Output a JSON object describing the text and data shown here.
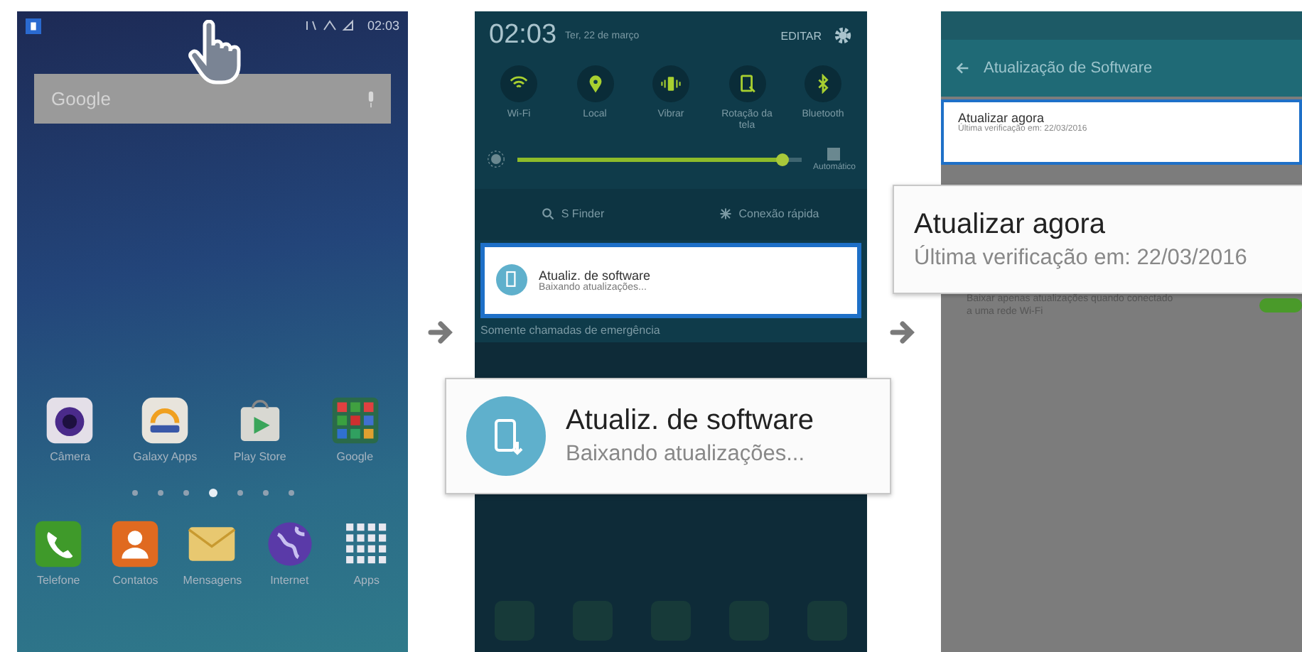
{
  "home_screen": {
    "status_bar": {
      "time": "02:03"
    },
    "search_bar": {
      "placeholder": "Google"
    },
    "apps": [
      {
        "label": "Câmera",
        "kind": "camera"
      },
      {
        "label": "Galaxy Apps",
        "kind": "store"
      },
      {
        "label": "Play Store",
        "kind": "bag"
      },
      {
        "label": "Google",
        "kind": "folder"
      }
    ],
    "page_dots": [
      {
        "selected": false
      },
      {
        "selected": false
      },
      {
        "selected": false
      },
      {
        "selected": true
      },
      {
        "selected": false
      },
      {
        "selected": false
      },
      {
        "selected": false
      }
    ],
    "dock": [
      {
        "label": "Telefone",
        "kind": "phone"
      },
      {
        "label": "Contatos",
        "kind": "person"
      },
      {
        "label": "Mensagens",
        "kind": "envelope"
      },
      {
        "label": "Internet",
        "kind": "globe"
      },
      {
        "label": "Apps",
        "kind": "grid"
      }
    ]
  },
  "notification_panel": {
    "time": "02:03",
    "date": "Ter, 22 de março",
    "edit_button": "EDITAR",
    "quick_toggles": [
      {
        "label": "Wi-Fi",
        "kind": "wifi",
        "on": true
      },
      {
        "label": "Local",
        "kind": "location",
        "on": true
      },
      {
        "label": "Vibrar",
        "kind": "vibrate",
        "on": true
      },
      {
        "label": "Rotação da tela",
        "kind": "rotation",
        "on": true
      },
      {
        "label": "Bluetooth",
        "kind": "bluetooth",
        "on": true
      }
    ],
    "brightness": {
      "level": 0.93,
      "label": "Automático"
    },
    "s_finder": "S Finder",
    "quick_connect": "Conexão rápida",
    "notification": {
      "title": "Atualiz. de software",
      "subtitle": "Baixando atualizações..."
    },
    "emergency_text": "Somente chamadas de emergência"
  },
  "notification_callout": {
    "title": "Atualiz. de software",
    "subtitle": "Baixando atualizações..."
  },
  "update_screen": {
    "title": "Atualização de Software",
    "update_item": {
      "title": "Atualizar agora",
      "subtitle": "Última verificação em: 22/03/2016"
    },
    "wifi_only": {
      "text": "Baixar apenas atualizações quando conectado a uma rede Wi-Fi",
      "on": true
    }
  },
  "update_callout": {
    "title": "Atualizar agora",
    "subtitle": "Última verificação em: 22/03/2016"
  }
}
